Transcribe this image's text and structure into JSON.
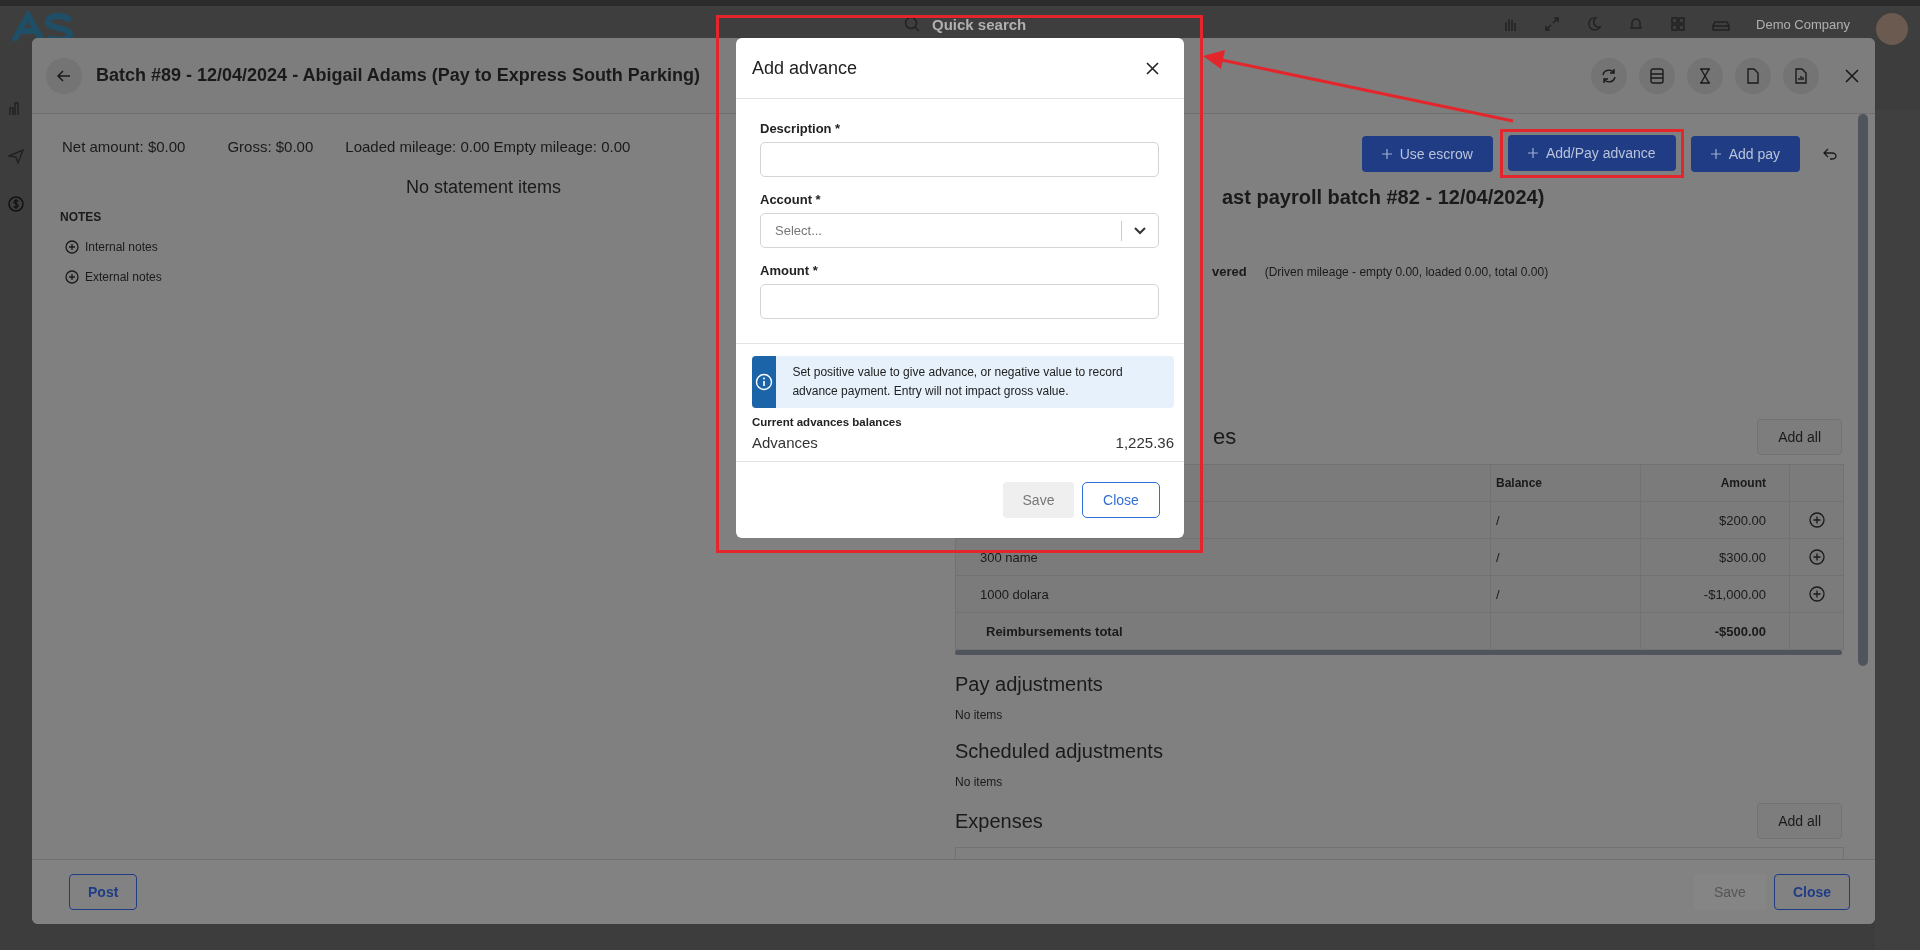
{
  "app_bar": {
    "search_placeholder": "Quick search",
    "company": "Demo Company"
  },
  "batch": {
    "title": "Batch #89 - 12/04/2024 - Abigail Adams  (Pay to Express South Parking)",
    "summary": [
      {
        "text": "Net amount: $0.00"
      },
      {
        "text": "Gross: $0.00"
      },
      {
        "text": "Loaded mileage: 0.00"
      },
      {
        "text": "Empty mileage: 0.00"
      }
    ],
    "empty_message": "No statement items",
    "notes_heading": "NOTES",
    "notes": [
      {
        "label": "Internal notes"
      },
      {
        "label": "External notes"
      }
    ],
    "actions": [
      {
        "label": "Use escrow",
        "highlighted": false
      },
      {
        "label": "Add/Pay advance",
        "highlighted": true
      },
      {
        "label": "Add pay",
        "highlighted": false
      }
    ],
    "heading_fragment": "ast payroll batch #82 - 12/04/2024)",
    "status_fragment": "vered",
    "mileage_note": "(Driven mileage - empty 0.00, loaded 0.00, total 0.00)",
    "reimbursements": {
      "title_fragment": "es",
      "add_all": "Add all",
      "columns": [
        {
          "label": "Balance"
        },
        {
          "label": "Amount"
        }
      ],
      "rows": [
        {
          "balance": "/",
          "amount": "$200.00"
        },
        {
          "name": "300 name",
          "balance": "/",
          "amount": "$300.00"
        },
        {
          "name": "1000 dolara",
          "balance": "/",
          "amount": "-$1,000.00"
        }
      ],
      "total": {
        "label": "Reimbursements total",
        "amount": "-$500.00"
      }
    },
    "sections": [
      {
        "title": "Pay adjustments",
        "empty": "No items"
      },
      {
        "title": "Scheduled adjustments",
        "empty": "No items"
      }
    ],
    "expenses": {
      "title": "Expenses",
      "add_all": "Add all"
    },
    "footer": {
      "post": "Post",
      "save": "Save",
      "save_disabled": true,
      "close": "Close"
    }
  },
  "modal": {
    "title": "Add advance",
    "fields": [
      {
        "kind": "text",
        "label": "Description *"
      },
      {
        "kind": "select",
        "label": "Account *",
        "placeholder": "Select..."
      },
      {
        "kind": "text",
        "label": "Amount *"
      }
    ],
    "info": "Set positive value to give advance, or negative value to record advance payment. Entry will not impact gross value.",
    "balances_heading": "Current advances balances",
    "balances": [
      {
        "label": "Advances",
        "value": "1,225.36"
      }
    ],
    "save": "Save",
    "save_disabled": true,
    "close": "Close"
  }
}
